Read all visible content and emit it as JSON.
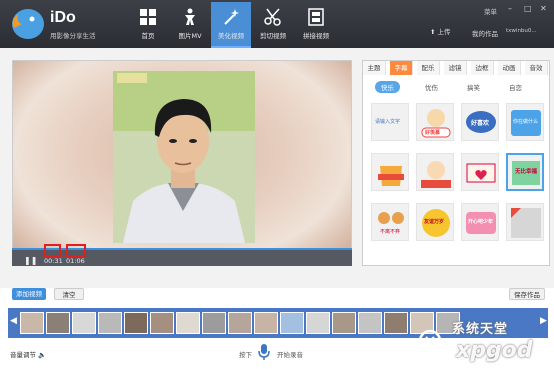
{
  "app": {
    "name": "iDo",
    "subtitle": "用影像分享生活"
  },
  "nav": {
    "items": [
      {
        "label": "首页",
        "icon": "grid-icon"
      },
      {
        "label": "图片MV",
        "icon": "figure-icon"
      },
      {
        "label": "美化视频",
        "icon": "magic-wand-icon",
        "active": true
      },
      {
        "label": "剪切视频",
        "icon": "scissors-icon"
      },
      {
        "label": "拼接视频",
        "icon": "film-icon"
      }
    ]
  },
  "header": {
    "menu": "菜单",
    "upload": "上传",
    "my_works": "我的作品",
    "user": "txwinbu0..."
  },
  "player": {
    "current_time": "00:31",
    "total_time": "01:06"
  },
  "panel": {
    "tabs": [
      "主题",
      "字幕",
      "配乐",
      "滤镜",
      "边框",
      "动画",
      "音效"
    ],
    "active_tab": "字幕",
    "subtabs": [
      "快乐",
      "忧伤",
      "搞笑",
      "自恋"
    ],
    "active_subtab": "快乐",
    "stickers": [
      "请输入文字",
      "好羡慕",
      "好喜欢",
      "你在做什么",
      "",
      "",
      "",
      "无比幸福",
      "",
      "不离不弃",
      "友谊万岁",
      "开心吧少年",
      ""
    ]
  },
  "actions": {
    "add_video": "添加视频",
    "clear": "清空",
    "save": "保存作品"
  },
  "bottom": {
    "volume": "音量调节",
    "press": "按下",
    "record": "开始录音"
  },
  "watermark": {
    "text": "系统天堂",
    "url": "xpgod"
  },
  "colors": {
    "accent": "#4a8fd6",
    "tab_active": "#ff8a3d",
    "filmstrip": "#4a78c4"
  }
}
